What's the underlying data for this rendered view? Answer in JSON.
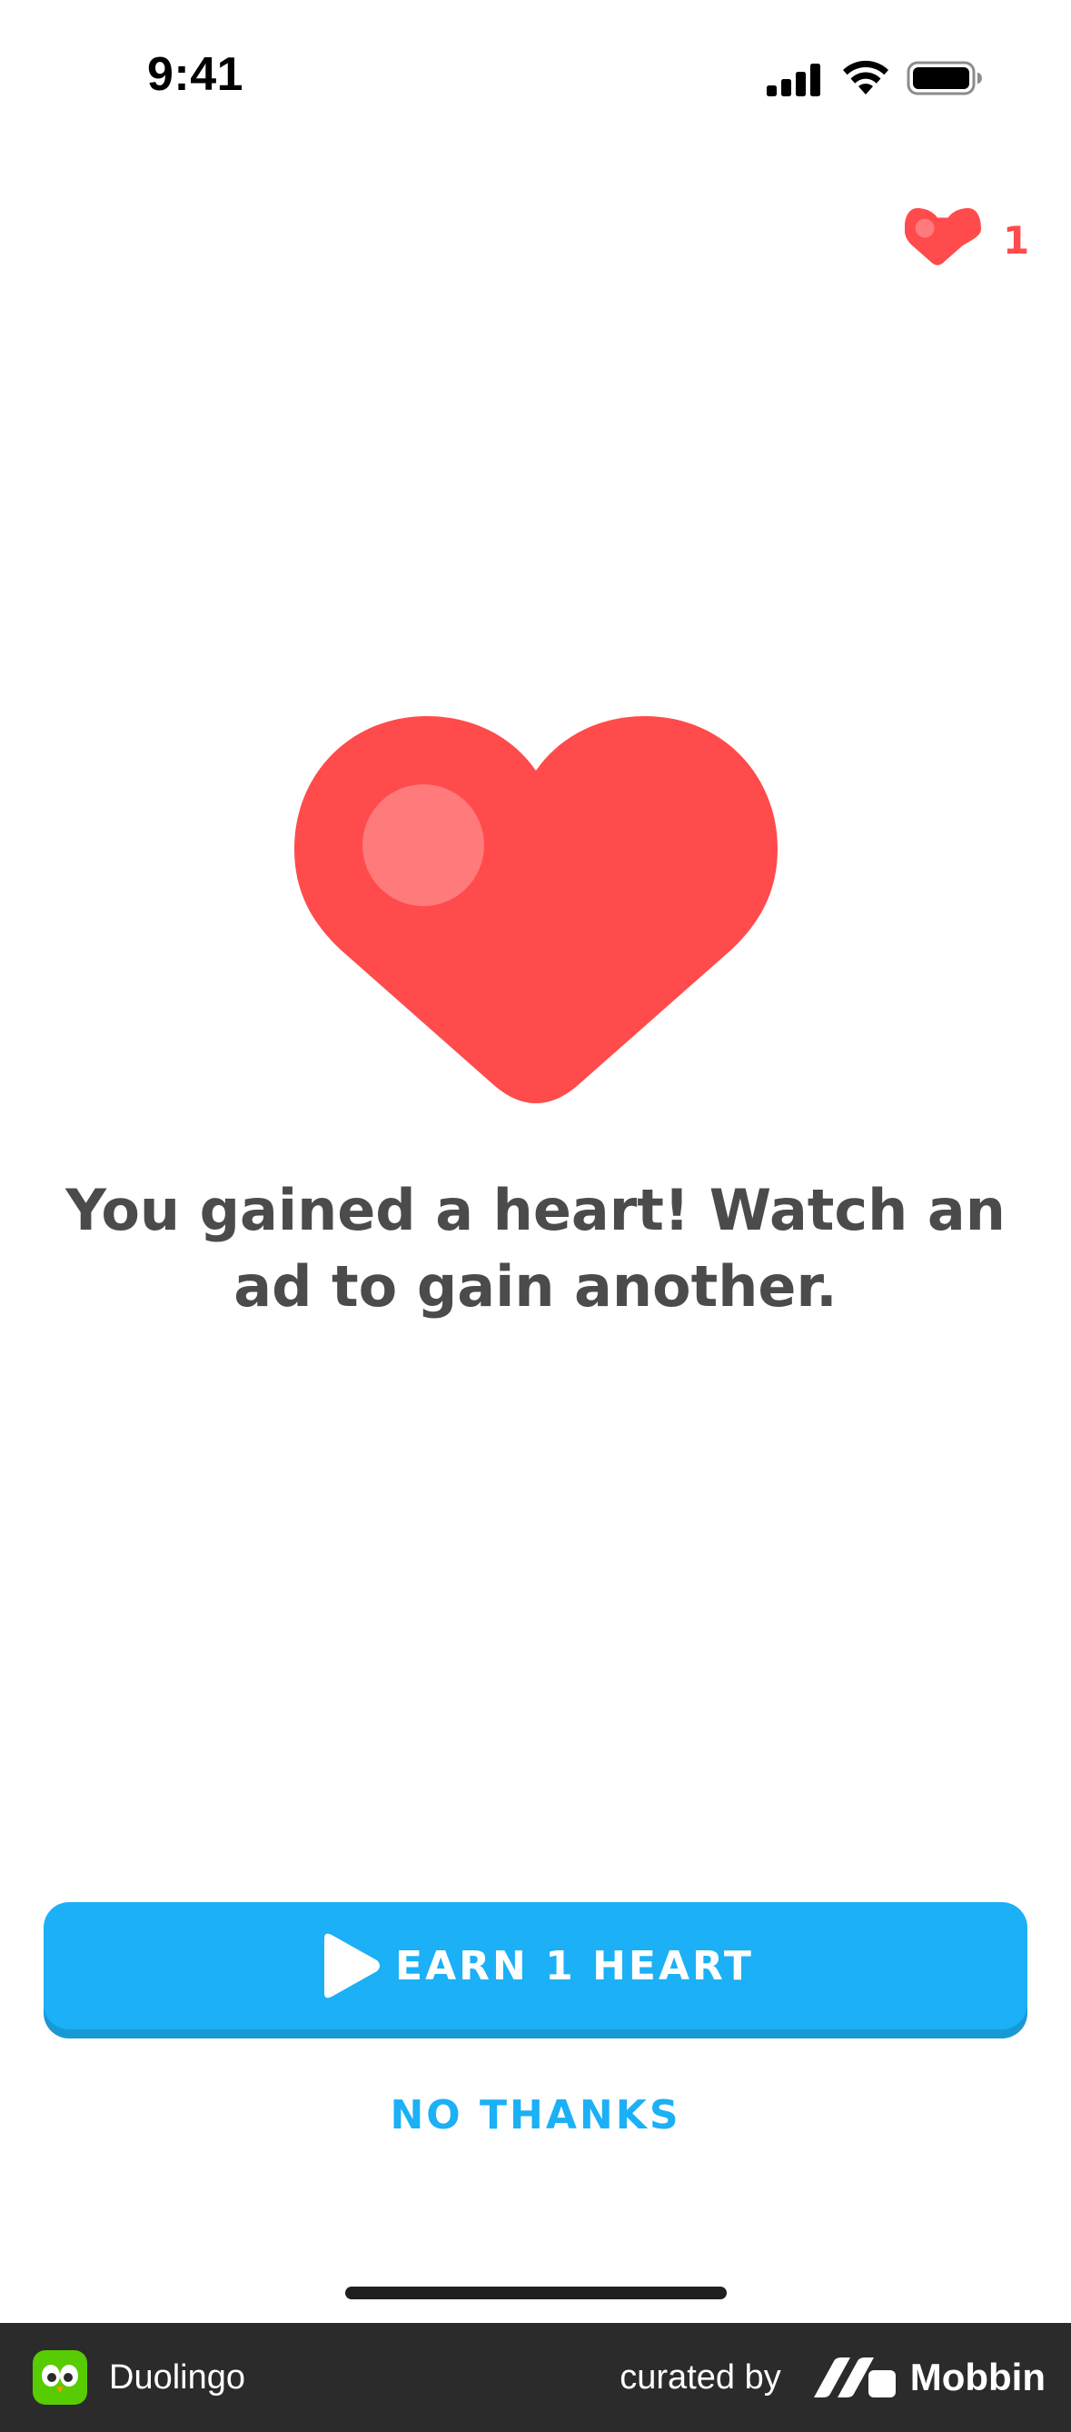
{
  "status_bar": {
    "time": "9:41",
    "signal_icon": "cellular-signal-icon",
    "wifi_icon": "wifi-icon",
    "battery_icon": "battery-icon"
  },
  "header": {
    "hearts_icon": "heart-icon",
    "hearts_count": "1"
  },
  "main": {
    "illustration_icon": "heart-icon",
    "message": "You gained a heart! Watch an ad to gain another."
  },
  "actions": {
    "earn_label": "EARN 1 HEART",
    "earn_icon": "play-icon",
    "no_thanks_label": "NO THANKS"
  },
  "footer": {
    "app_name": "Duolingo",
    "curated_label": "curated by",
    "brand_name": "Mobbin"
  },
  "colors": {
    "heart_red": "#FF4B4B",
    "heart_highlight": "#FF7A7A",
    "primary_blue": "#1CB0F6",
    "primary_blue_shadow": "#1899D6",
    "text_gray": "#4B4B4B",
    "footer_bg": "#2B2B2B",
    "duolingo_green": "#58CC02"
  }
}
